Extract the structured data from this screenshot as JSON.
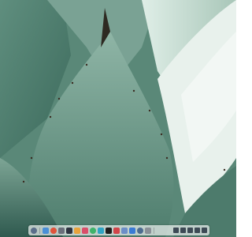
{
  "desktop": {
    "wallpaper": "agave-plant",
    "wallpaper_colors": {
      "dark": "#2f5a4f",
      "mid": "#6f9c8c",
      "light": "#bcd3c8",
      "highlight": "#eef5f1"
    }
  },
  "dock": {
    "apps": [
      {
        "name": "launcher-icon",
        "color": "#5b6e8a"
      },
      {
        "name": "file-manager-icon",
        "color": "#4a8fd6"
      },
      {
        "name": "browser-icon",
        "color": "#e0533b"
      },
      {
        "name": "camera-icon",
        "color": "#6a6f7a"
      },
      {
        "name": "terminal-icon",
        "color": "#2e3440"
      },
      {
        "name": "photos-icon",
        "color": "#e8a33c"
      },
      {
        "name": "mail-icon",
        "color": "#d94f6a"
      },
      {
        "name": "chat-icon",
        "color": "#3fb36a"
      },
      {
        "name": "music-icon",
        "color": "#2fa4c4"
      },
      {
        "name": "video-icon",
        "color": "#1f1f1f"
      },
      {
        "name": "calendar-icon",
        "color": "#d1454a"
      },
      {
        "name": "text-editor-icon",
        "color": "#6c8ec7"
      },
      {
        "name": "store-icon",
        "color": "#3a7bd5"
      },
      {
        "name": "settings-icon",
        "color": "#4d6c8f"
      },
      {
        "name": "trash-icon",
        "color": "#8a9097"
      }
    ],
    "tray": [
      {
        "name": "network-icon",
        "color": "#3d4a55"
      },
      {
        "name": "volume-icon",
        "color": "#3d4a55"
      },
      {
        "name": "battery-icon",
        "color": "#3d4a55"
      },
      {
        "name": "notification-icon",
        "color": "#3d4a55"
      },
      {
        "name": "power-icon",
        "color": "#3d4a55"
      }
    ]
  }
}
